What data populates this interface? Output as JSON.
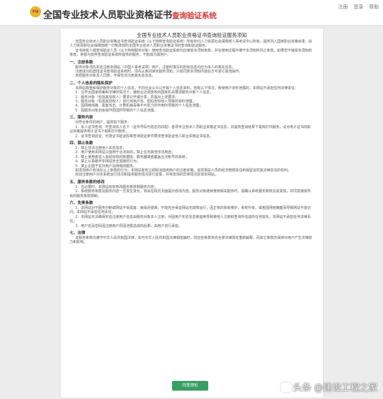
{
  "header": {
    "logo_text": "PTA",
    "title": "全国专业技术人员职业资格证书",
    "subtitle": "查询验证系统",
    "links": [
      "注册",
      "登录",
      "帮助"
    ]
  },
  "doc": {
    "title": "全国专业技术人员职业资格证书查询验证服务须知",
    "intro": [
      "全国专业技术人员职业资格证书查询验证系统（以下简称查询验证系统）所有权归人力资源社会保障部人事考试中心所有，提供列入国家职业资格目录、由人力资源和社会保障部统一印制发放的全国专业技术人员职业资格证书的查询和验证服务。",
      "证书持有人或查询验证人员（以下简称服务对象）使用查询验证系统均应接受本须知条款，并在使用过程中遵守本须知所列之条款。如果您不接受本须知的条款，将视为放弃查询验证系统所提供的服务，不能成为其用户。"
    ],
    "sections": [
      {
        "heading": "一、注册条款",
        "paras": [
          "服务对象须先实名注册本网站（中国人事考试网）用户，注册时填写的所有信息均应为本人的真实信息。",
          "注册成功后登陆证书查询验证系统时，须先认真阅读本服务须知，只有同意本须知内容后方可进行其他操作。",
          "未经服务对象本人同意，不得非法注册其实名信息。"
        ]
      },
      {
        "heading": "二、个人信息的隐私保护",
        "paras": [
          "本网站尊重和保护服务对象的个人信息，不向社会公众公开其个人信息资料。但有以下情况，致使用户资料泄露的，本网站不承担任何法律责任：",
          "1．在符合国家政策和法律的情况下，拥有合法调查权的国家机关要求服务对象个人信息；",
          "2．服务对象（包括其授权人）要求公开或分享，并提出上述要求；",
          "3．服务对象（包括其授权人）自行将用户名、密码告知他人导致的资料泄露；",
          "4．因网络线路、黑客攻击、计算机病毒等不可抗力的作用所导致的个人信息泄露；",
          "5．因服务对象自身操作原因所导致的个人信息泄露。"
        ]
      },
      {
        "heading": "三、服务内容",
        "paras": [
          "对符合条件的用户，提供如下服务：",
          "1．本人证书查询。可查询本人名下（证件号码与姓名均匹配）各项专业技术人员职业资格证书信息，并提供查询结果下载和打印服务，试点电子证书的职业资格提供电子证书下载和打印服务；",
          "2．证书查询验证。可按证书验证码等查询验证条件要求查询验证他人职业资格证书信息。"
        ]
      },
      {
        "heading": "四、禁止条款",
        "paras": [
          "1．禁止非法注册他人实名信息；",
          "2．用户使用本网站只能用于合法目的，禁止任何其他非法用途；",
          "3．禁止使用者进入未经授权的数据库、服务器或者覆盖合法帐号的系统；",
          "4．禁止从事破坏本网站安全措施的行为；",
          "5．禁止企图干扰对用户及网络的服务。",
          "如发现用户有违反以上条款的行为，本网站有权立即取消滥用用户的注册资格，追究相关人员的经济赔偿责任和保留追究其法律责任的权利。",
          "欢迎注册用户对本系统运行情况和提供服务情况进行监督，并将发现的异常情况反馈本网站。"
        ]
      },
      {
        "heading": "五、服务条款的修改",
        "paras": [
          "1．在必要时，本网站有权修改服务条款和服务内容；",
          "2．系统服务条款及服务内容一旦发生变化，将会在网页页面提示修改内容。服务对象继续使用相关服务时，需确认系统服务条款及其变动，并同意接受所有的服务条款限制。"
        ]
      },
      {
        "heading": "六、免责条款",
        "paras": [
          "1．本网站对于服务中断或网站不受黑客、病毒的侵袭，不能完全保证网站无故障运行；因正常的系统维护、系统升级，或者因网络拥塞而导致网站不能访问，本网站不承担任何责任；",
          "2．本网站无法确保实名注册用户信息由服务对象本人注册，对因用户实名信息被盗用导致被他人注册和查询所造成的任何损失，本网站不承担任何法律责任；",
          "3．用户名及密码因注册用户原因泄露造成的后果，由用户自行承担。"
        ]
      },
      {
        "heading": "七、法律",
        "paras": [
          "本服务条款均遵守中华人民共和国法律，如与中华人民共和国法律相抵触时，则这些条款将完全按法律规定重新解释，而其它条款仍保持对用户产生法律效力和影响。"
        ]
      }
    ],
    "button_label": "同意须知"
  },
  "watermark": "头条 @建设工程之家"
}
